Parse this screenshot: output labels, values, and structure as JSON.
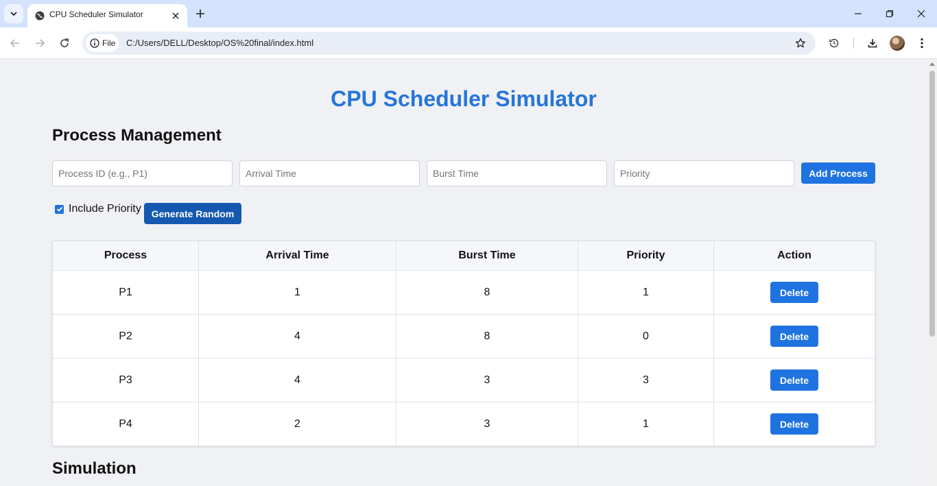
{
  "browser": {
    "tab_title": "CPU Scheduler Simulator",
    "chip_label": "File",
    "url": "C:/Users/DELL/Desktop/OS%20final/index.html"
  },
  "page": {
    "title": "CPU Scheduler Simulator",
    "section_process": "Process Management",
    "section_simulation": "Simulation",
    "inputs": {
      "process_id_placeholder": "Process ID (e.g., P1)",
      "arrival_placeholder": "Arrival Time",
      "burst_placeholder": "Burst Time",
      "priority_placeholder": "Priority"
    },
    "add_button": "Add Process",
    "include_priority_label": "Include Priority",
    "include_priority_checked": true,
    "generate_button": "Generate Random",
    "table": {
      "headers": [
        "Process",
        "Arrival Time",
        "Burst Time",
        "Priority",
        "Action"
      ],
      "rows": [
        {
          "process": "P1",
          "arrival": "1",
          "burst": "8",
          "priority": "1",
          "action": "Delete"
        },
        {
          "process": "P2",
          "arrival": "4",
          "burst": "8",
          "priority": "0",
          "action": "Delete"
        },
        {
          "process": "P3",
          "arrival": "4",
          "burst": "3",
          "priority": "3",
          "action": "Delete"
        },
        {
          "process": "P4",
          "arrival": "2",
          "burst": "3",
          "priority": "1",
          "action": "Delete"
        }
      ]
    }
  },
  "colors": {
    "accent": "#1f73e0",
    "title": "#2675d9",
    "tabbar": "#d3e3fd"
  }
}
